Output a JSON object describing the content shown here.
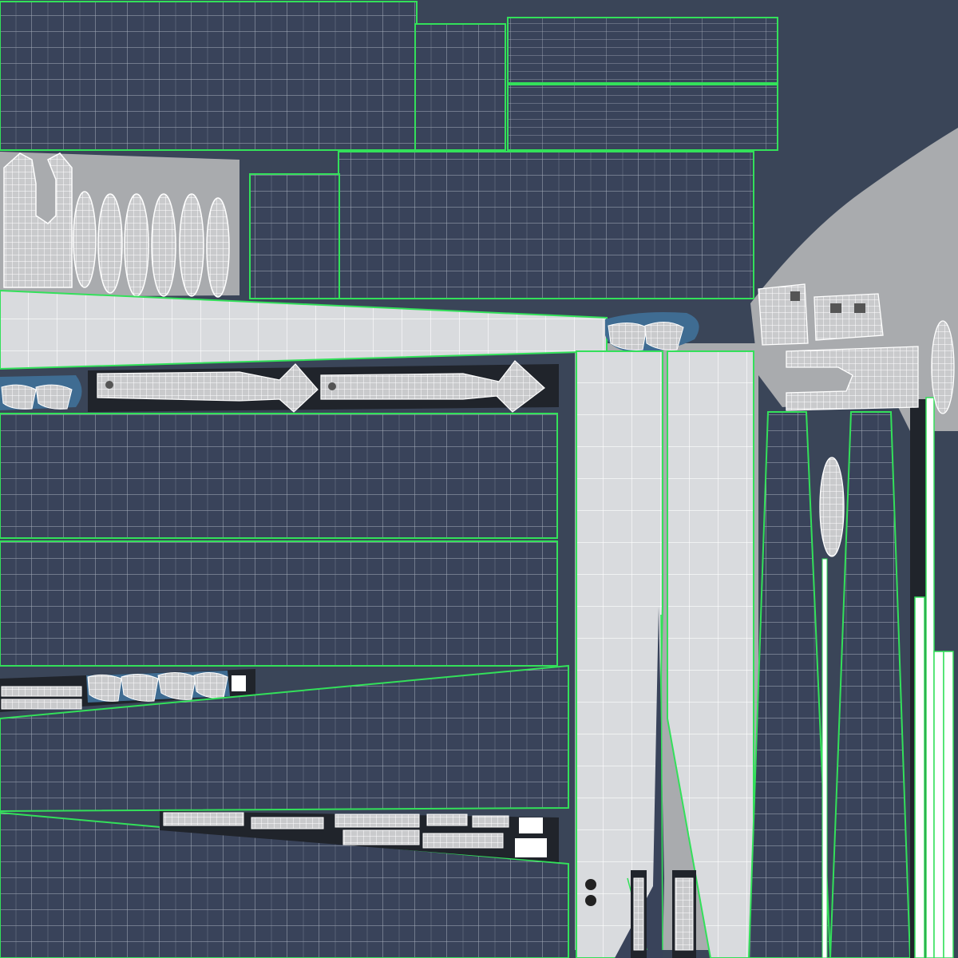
{
  "uv_layout": {
    "colors": {
      "background": "#3a4558",
      "panel_fill": "#39435a",
      "panel_grid": "#cfd6e0",
      "seam": "#33e05a",
      "light_strip": "#d9dbde",
      "light_grid": "#ffffff",
      "padding": "#a9abae",
      "shadow": "#20242b",
      "blue_shell": "#3f6c92",
      "wire": "#f2f2f2"
    }
  }
}
